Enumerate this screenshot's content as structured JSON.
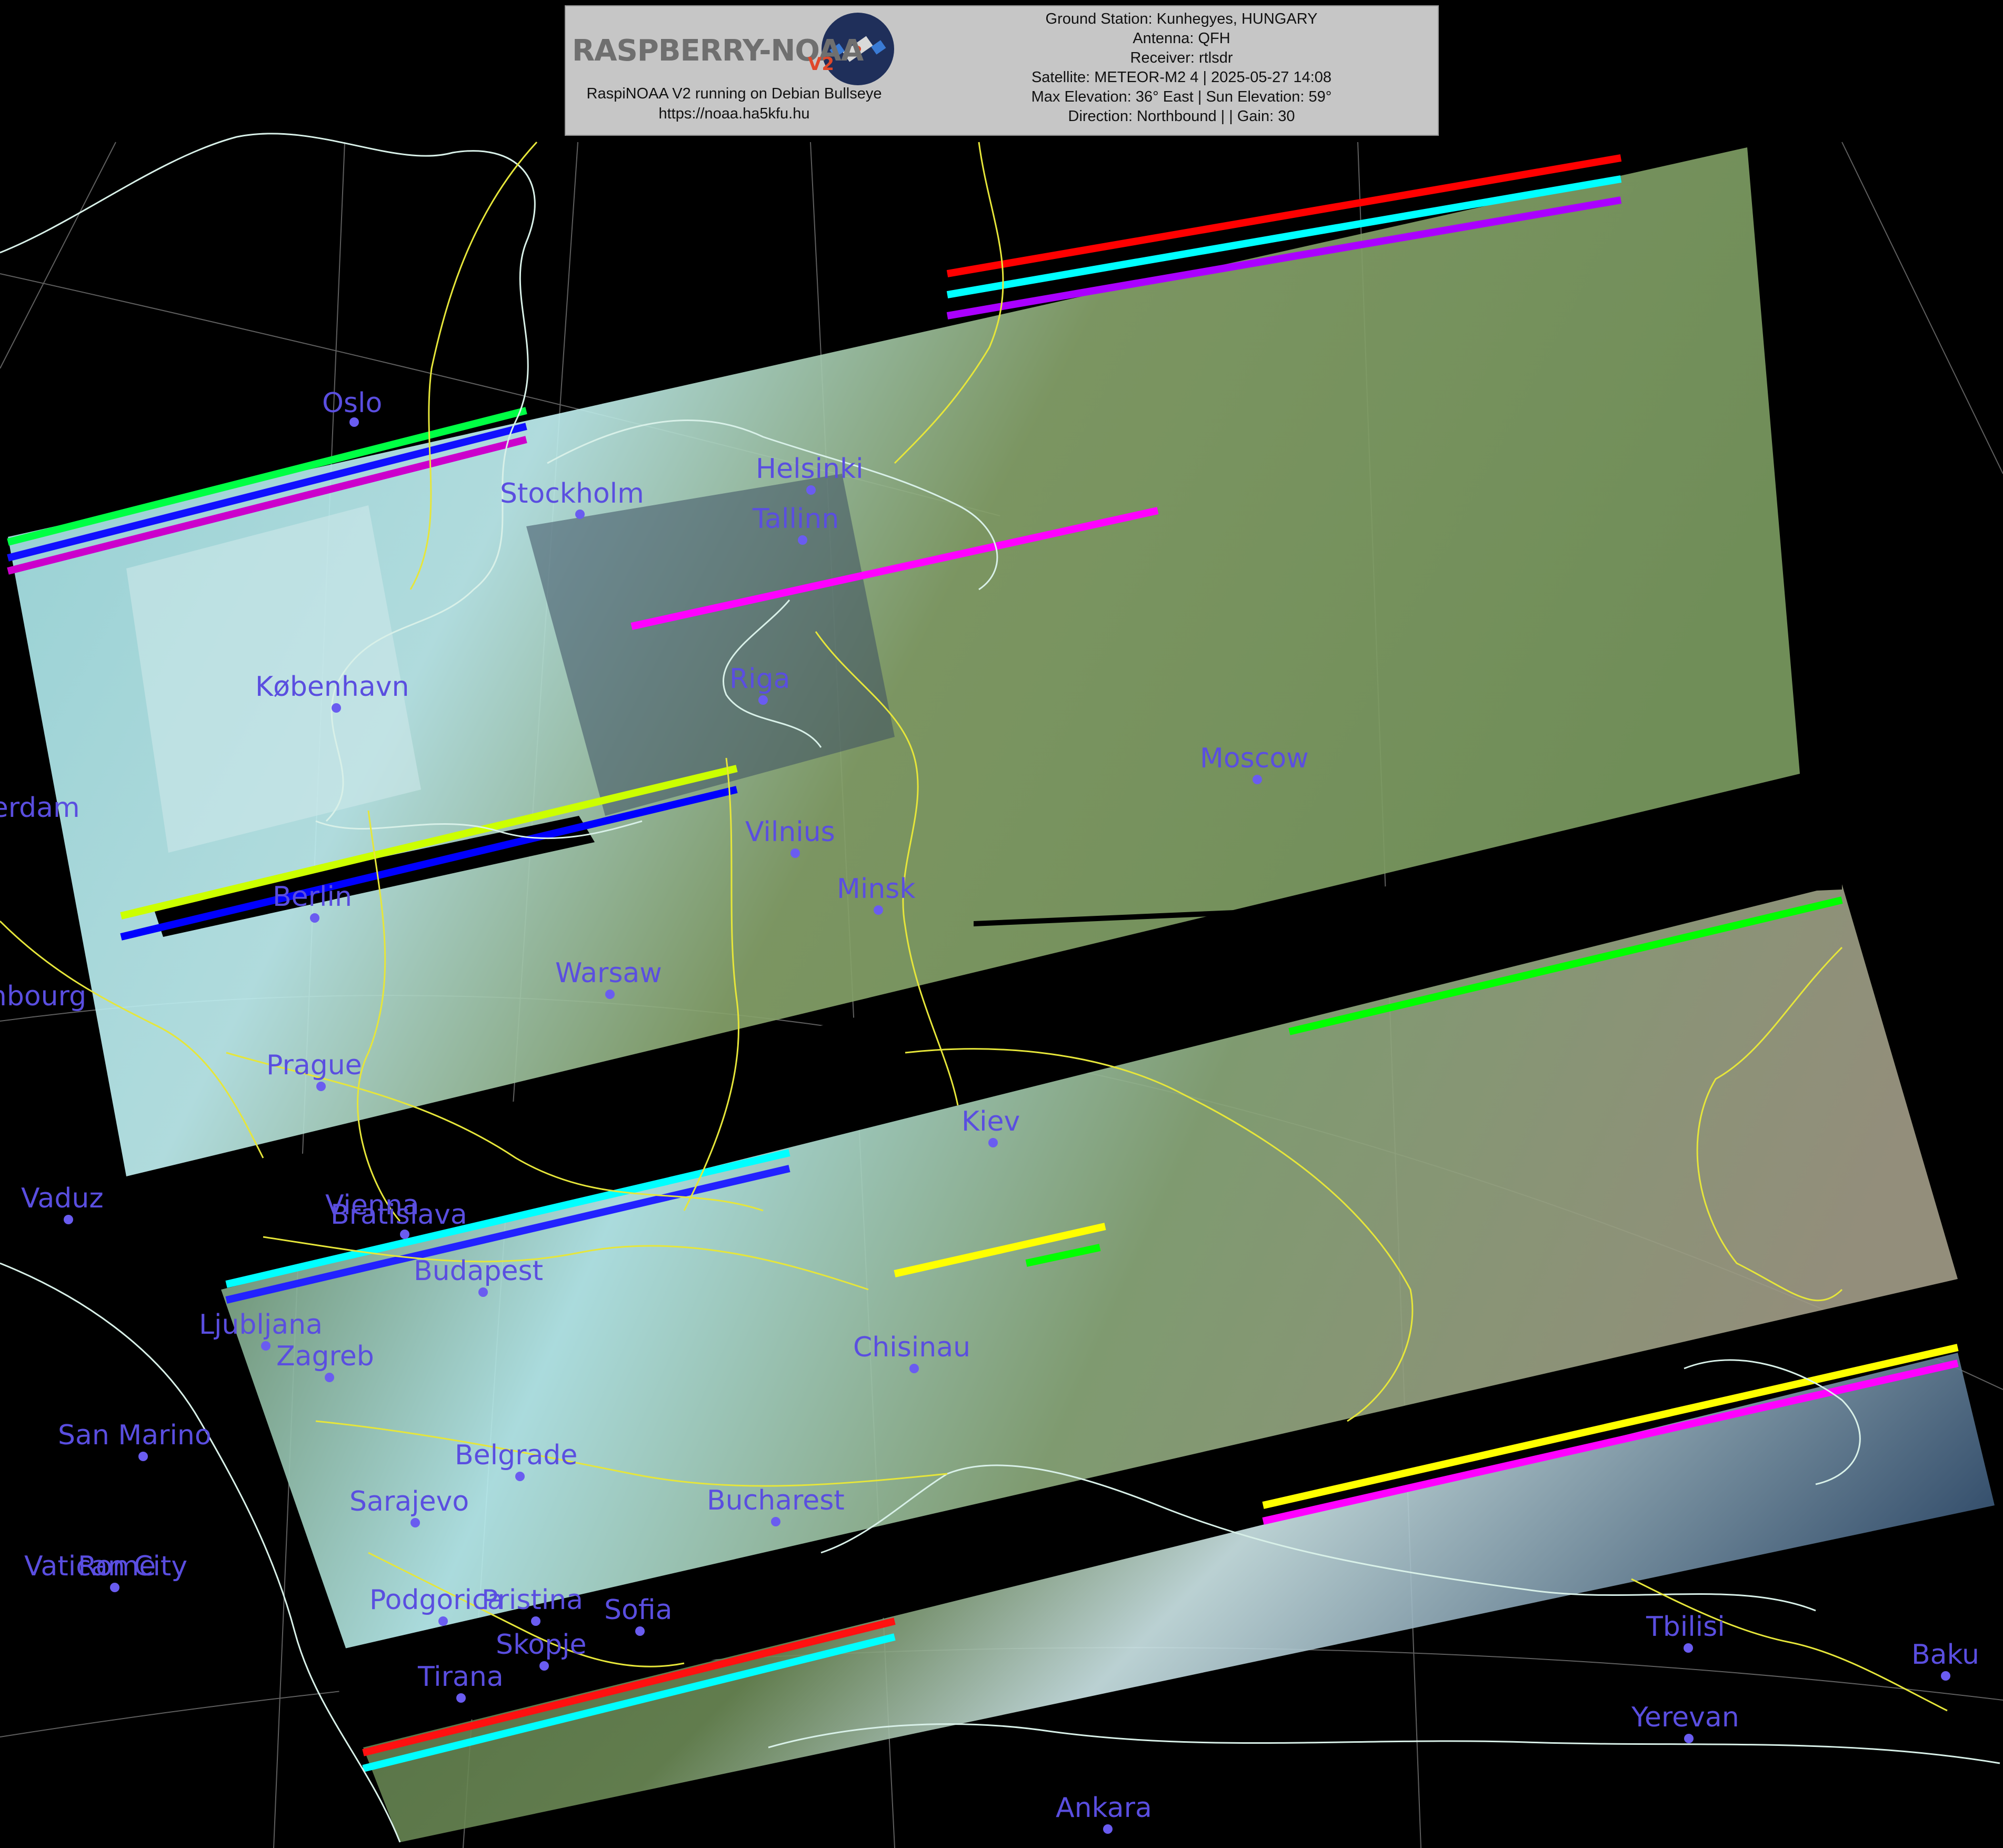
{
  "header": {
    "logo_text": "RASPBERRY-NOAA",
    "logo_badge": "V2",
    "subtitle": "RaspiNOAA V2 running on Debian Bullseye",
    "url": "https://noaa.ha5kfu.hu",
    "ground_station": "Ground Station: Kunhegyes, HUNGARY",
    "antenna": "Antenna: QFH",
    "receiver": "Receiver: rtlsdr",
    "satellite": "Satellite: METEOR-M2 4 | 2025-05-27 14:08",
    "elevation": "Max Elevation: 36° East | Sun Elevation: 59°",
    "direction": "Direction: Northbound | | Gain: 30"
  },
  "icons": {
    "logo": "satellite-icon"
  },
  "colors": {
    "background": "#000000",
    "city_label": "#5a4ee0",
    "borders": "#e6e63a",
    "coastlines": "#d8f0e8",
    "graticule": "#8a8a8a",
    "panel": "#c6c6c6"
  },
  "cities": [
    {
      "name": "Oslo"
    },
    {
      "name": "Stockholm"
    },
    {
      "name": "Helsinki"
    },
    {
      "name": "Tallinn"
    },
    {
      "name": "Riga"
    },
    {
      "name": "København"
    },
    {
      "name": "Moscow"
    },
    {
      "name": "Vilnius"
    },
    {
      "name": "Minsk"
    },
    {
      "name": "Berlin"
    },
    {
      "name": "Warsaw"
    },
    {
      "name": "Prague"
    },
    {
      "name": "Kiev"
    },
    {
      "name": "Vienna"
    },
    {
      "name": "Bratislava"
    },
    {
      "name": "Vaduz"
    },
    {
      "name": "Budapest"
    },
    {
      "name": "Ljubljana"
    },
    {
      "name": "Zagreb"
    },
    {
      "name": "Chisinau"
    },
    {
      "name": "San Marino"
    },
    {
      "name": "Belgrade"
    },
    {
      "name": "Sarajevo"
    },
    {
      "name": "Bucharest"
    },
    {
      "name": "Vatican City"
    },
    {
      "name": "Rome"
    },
    {
      "name": "Podgorica"
    },
    {
      "name": "Pristina"
    },
    {
      "name": "Sofia"
    },
    {
      "name": "Skopje"
    },
    {
      "name": "Tirana"
    },
    {
      "name": "Tbilisi"
    },
    {
      "name": "Baku"
    },
    {
      "name": "Yerevan"
    },
    {
      "name": "Ankara"
    },
    {
      "name": "Amsterdam"
    },
    {
      "name": "Luxembourg"
    }
  ]
}
